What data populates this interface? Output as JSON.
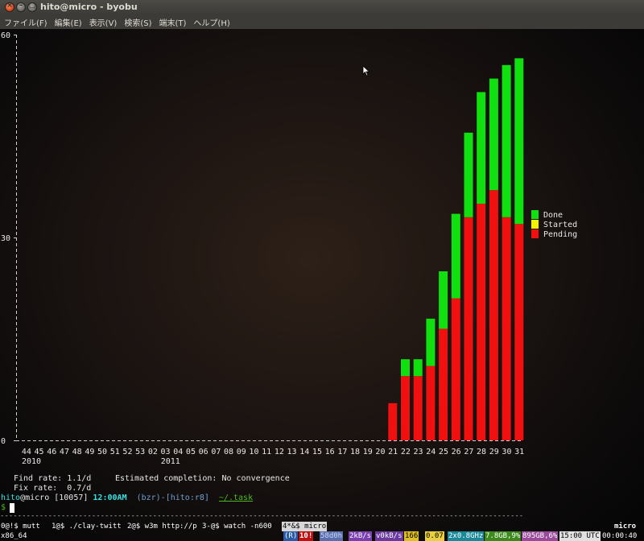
{
  "window": {
    "title": "hito@micro - byobu",
    "close_glyph": "×",
    "min_glyph": "–",
    "max_glyph": "□"
  },
  "menu": [
    "ファイル(F)",
    "編集(E)",
    "表示(V)",
    "検索(S)",
    "端末(T)",
    "ヘルプ(H)"
  ],
  "colors": {
    "done": "#10e010",
    "started": "#f0f000",
    "pending": "#f01010",
    "prompt_cyan": "#34e2e2",
    "prompt_green": "#4eb91f",
    "prompt_blue": "#729fcf"
  },
  "chart_data": {
    "type": "bar",
    "stacked": true,
    "ylim": [
      0,
      60
    ],
    "yticks": [
      "60",
      "30",
      "0"
    ],
    "xlabel": "",
    "ylabel": "",
    "title": "",
    "categories": [
      "44",
      "45",
      "46",
      "47",
      "48",
      "49",
      "50",
      "51",
      "52",
      "53",
      "02",
      "03",
      "04",
      "05",
      "06",
      "07",
      "08",
      "09",
      "10",
      "11",
      "12",
      "13",
      "14",
      "15",
      "16",
      "17",
      "18",
      "19",
      "20",
      "21",
      "22",
      "23",
      "24",
      "25",
      "26",
      "27",
      "28",
      "29",
      "30",
      "31"
    ],
    "year_labels": [
      {
        "label": "2010",
        "category": "44"
      },
      {
        "label": "2011",
        "category": "03"
      }
    ],
    "series": [
      {
        "name": "Pending",
        "values": [
          0,
          0,
          0,
          0,
          0,
          0,
          0,
          0,
          0,
          0,
          0,
          0,
          0,
          0,
          0,
          0,
          0,
          0,
          0,
          0,
          0,
          0,
          0,
          0,
          0,
          0,
          0,
          0,
          0,
          5.5,
          9.5,
          9.5,
          11,
          16.5,
          21,
          33,
          35,
          37,
          33,
          32
        ]
      },
      {
        "name": "Started",
        "values": [
          0,
          0,
          0,
          0,
          0,
          0,
          0,
          0,
          0,
          0,
          0,
          0,
          0,
          0,
          0,
          0,
          0,
          0,
          0,
          0,
          0,
          0,
          0,
          0,
          0,
          0,
          0,
          0,
          0,
          0,
          0,
          0,
          0,
          0,
          0,
          0,
          0,
          0,
          0,
          0
        ]
      },
      {
        "name": "Done",
        "values": [
          0,
          0,
          0,
          0,
          0,
          0,
          0,
          0,
          0,
          0,
          0,
          0,
          0,
          0,
          0,
          0,
          0,
          0,
          0,
          0,
          0,
          0,
          0,
          0,
          0,
          0,
          0,
          0,
          0,
          0,
          2.5,
          2.5,
          7,
          8.5,
          12.5,
          12.5,
          16.5,
          16.5,
          22.5,
          24.5
        ]
      }
    ],
    "legend": [
      "Done",
      "Started",
      "Pending"
    ],
    "legend_position": "right"
  },
  "terminal": {
    "find_rate": "Find rate: 1.1/d",
    "estimate": "Estimated completion: No convergence",
    "fix_rate": "Fix rate:  0.7/d",
    "prompt_user": "hito",
    "prompt_host": "@micro",
    "prompt_hist": " [10057] ",
    "prompt_time": "12:00AM",
    "prompt_vcs": "  (bzr)-[hito:r8]  ",
    "prompt_path": "~/.task",
    "prompt_symbol": "$",
    "separator": "------------------------------------------------------------------------------------------------------------------------"
  },
  "statusbar": {
    "windows": [
      {
        "label": "0@!$ mutt"
      },
      {
        "label": "1@$ ./clay-twitt"
      },
      {
        "label": "2@$ w3m http://p"
      },
      {
        "label": "3-@$ watch -n600"
      },
      {
        "label": "4*&$ micro"
      }
    ],
    "hostname": "micro",
    "arch": "x86_64",
    "release_badge": "(R)",
    "updates": "10!",
    "mem_id": "58d0h",
    "net_up": "2kB/s",
    "net_down": "v0kB/s",
    "temp": "166",
    "load": "0.07",
    "cpu": "2x0.8GHz",
    "mem": "7.8GB,9%",
    "disk": "895GB,6%",
    "time": "15:00 UTC",
    "clock": "00:00:40"
  }
}
